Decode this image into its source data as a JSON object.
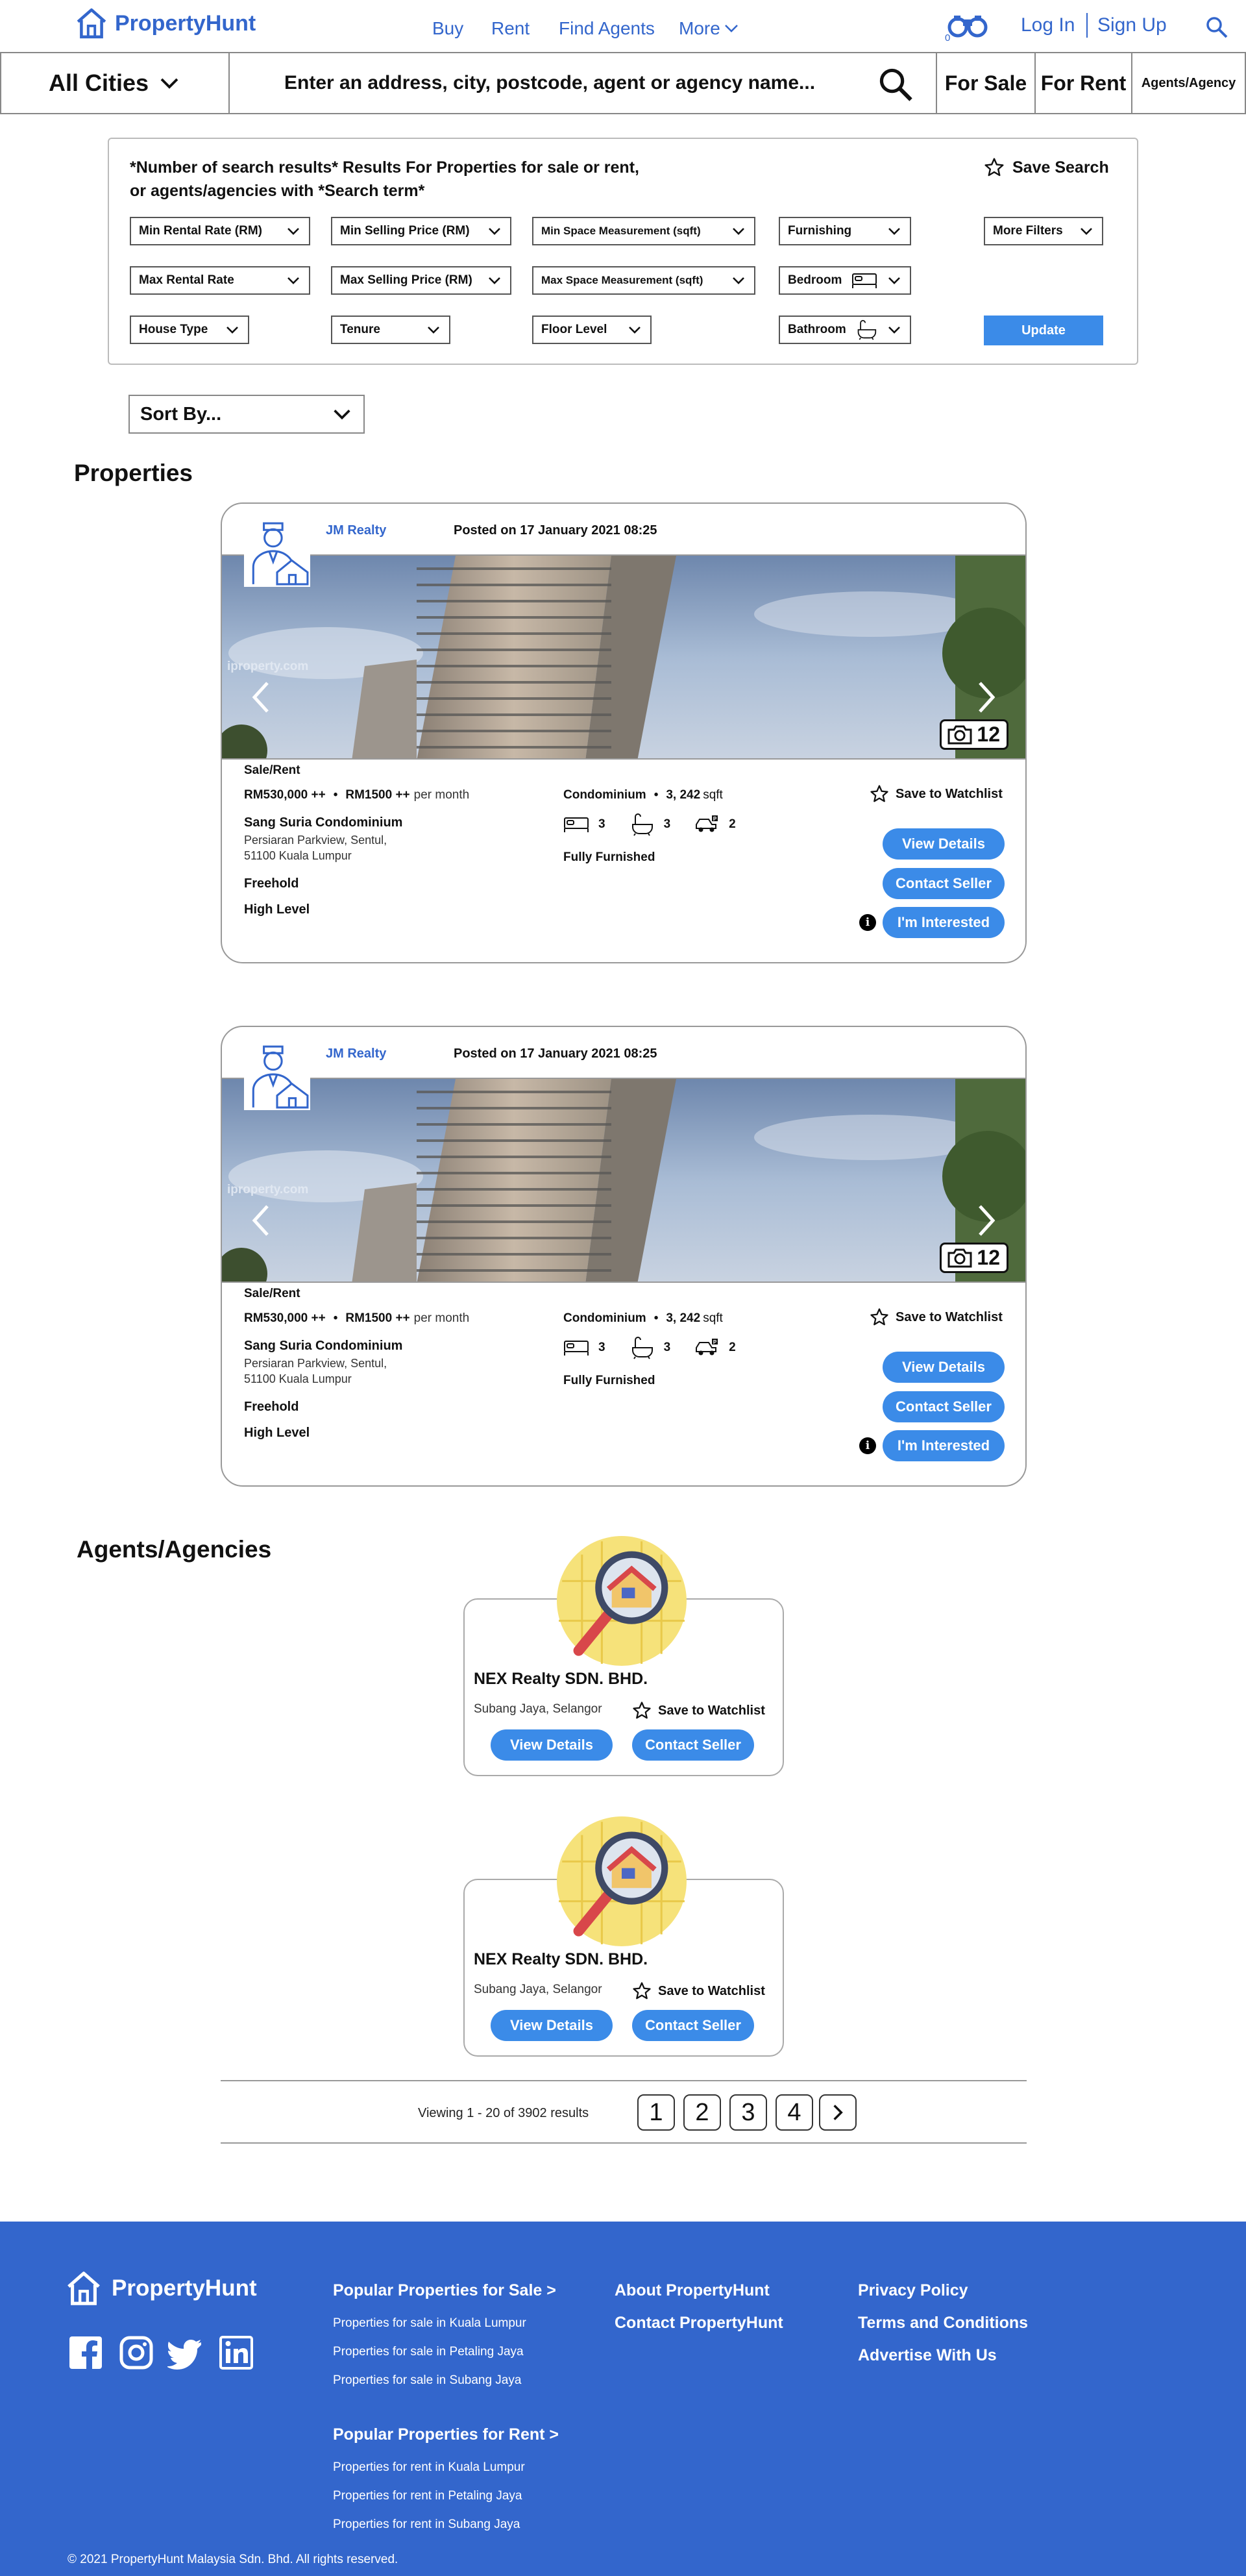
{
  "header": {
    "logo_text": "PropertyHunt",
    "nav": [
      "Buy",
      "Rent",
      "Find Agents",
      "More"
    ],
    "compare_badge": "0",
    "login": "Log In",
    "signup": "Sign Up"
  },
  "search": {
    "city": "All Cities",
    "placeholder": "Enter an address, city, postcode, agent or agency name...",
    "tabs": [
      "For Sale",
      "For Rent",
      "Agents/Agency"
    ]
  },
  "filters": {
    "title_line1": "*Number of search results* Results For Properties for sale or rent,",
    "title_line2": "or agents/agencies with *Search term*",
    "save_search": "Save Search",
    "min_rental": "Min Rental Rate (RM)",
    "min_selling": "Min Selling Price (RM)",
    "min_space": "Min Space Measurement (sqft)",
    "furnishing": "Furnishing",
    "more_filters": "More Filters",
    "max_rental": "Max Rental Rate",
    "max_selling": "Max Selling Price (RM)",
    "max_space": "Max Space Measurement (sqft)",
    "bedroom": "Bedroom",
    "house_type": "House Type",
    "tenure": "Tenure",
    "floor_level": "Floor Level",
    "bathroom": "Bathroom",
    "update": "Update"
  },
  "sort_label": "Sort By...",
  "properties_title": "Properties",
  "properties": [
    {
      "agent": "JM Realty",
      "posted": "Posted on 17 January 2021 08:25",
      "photo_count": "12",
      "watermark": "iproperty.com",
      "type": "Sale/Rent",
      "price_sale": "RM530,000 ++",
      "price_rent": "RM1500 ++",
      "per_month": "per month",
      "name": "Sang Suria Condominium",
      "address1": "Persiaran Parkview, Sentul,",
      "address2": "51100 Kuala Lumpur",
      "tenure": "Freehold",
      "level": "High Level",
      "category": "Condominium",
      "size": "3, 242",
      "size_unit": "sqft",
      "beds": "3",
      "baths": "3",
      "parking": "2",
      "furnishing": "Fully Furnished",
      "save": "Save to Watchlist",
      "view": "View Details",
      "contact": "Contact Seller",
      "interested": "I'm Interested",
      "info": "i"
    },
    {
      "agent": "JM Realty",
      "posted": "Posted on 17 January 2021 08:25",
      "photo_count": "12",
      "watermark": "iproperty.com",
      "type": "Sale/Rent",
      "price_sale": "RM530,000 ++",
      "price_rent": "RM1500 ++",
      "per_month": "per month",
      "name": "Sang Suria Condominium",
      "address1": "Persiaran Parkview, Sentul,",
      "address2": "51100 Kuala Lumpur",
      "tenure": "Freehold",
      "level": "High Level",
      "category": "Condominium",
      "size": "3, 242",
      "size_unit": "sqft",
      "beds": "3",
      "baths": "3",
      "parking": "2",
      "furnishing": "Fully Furnished",
      "save": "Save to Watchlist",
      "view": "View Details",
      "contact": "Contact Seller",
      "interested": "I'm Interested",
      "info": "i"
    }
  ],
  "agencies_title": "Agents/Agencies",
  "agencies": [
    {
      "name": "NEX Realty SDN. BHD.",
      "location": "Subang Jaya, Selangor",
      "save": "Save to Watchlist",
      "view": "View Details",
      "contact": "Contact Seller"
    },
    {
      "name": "NEX Realty SDN. BHD.",
      "location": "Subang Jaya, Selangor",
      "save": "Save to Watchlist",
      "view": "View Details",
      "contact": "Contact Seller"
    }
  ],
  "pagination": {
    "text": "Viewing 1 - 20 of 3902 results",
    "pages": [
      "1",
      "2",
      "3",
      "4"
    ]
  },
  "footer": {
    "logo_text": "PropertyHunt",
    "sale_head": "Popular Properties for Sale >",
    "sale_links": [
      "Properties for sale in Kuala Lumpur",
      "Properties for sale in Petaling Jaya",
      "Properties for sale in Subang Jaya"
    ],
    "rent_head": "Popular Properties for Rent >",
    "rent_links": [
      "Properties for rent in Kuala Lumpur",
      "Properties for rent in Petaling Jaya",
      "Properties for rent in Subang Jaya"
    ],
    "about": "About PropertyHunt",
    "contact": "Contact PropertyHunt",
    "privacy": "Privacy Policy",
    "terms": "Terms and Conditions",
    "advertise": "Advertise With Us",
    "copyright": "© 2021 PropertyHunt Malaysia Sdn. Bhd. All rights reserved."
  },
  "colors": {
    "brand": "#3366cc",
    "button": "#3b8be8"
  }
}
